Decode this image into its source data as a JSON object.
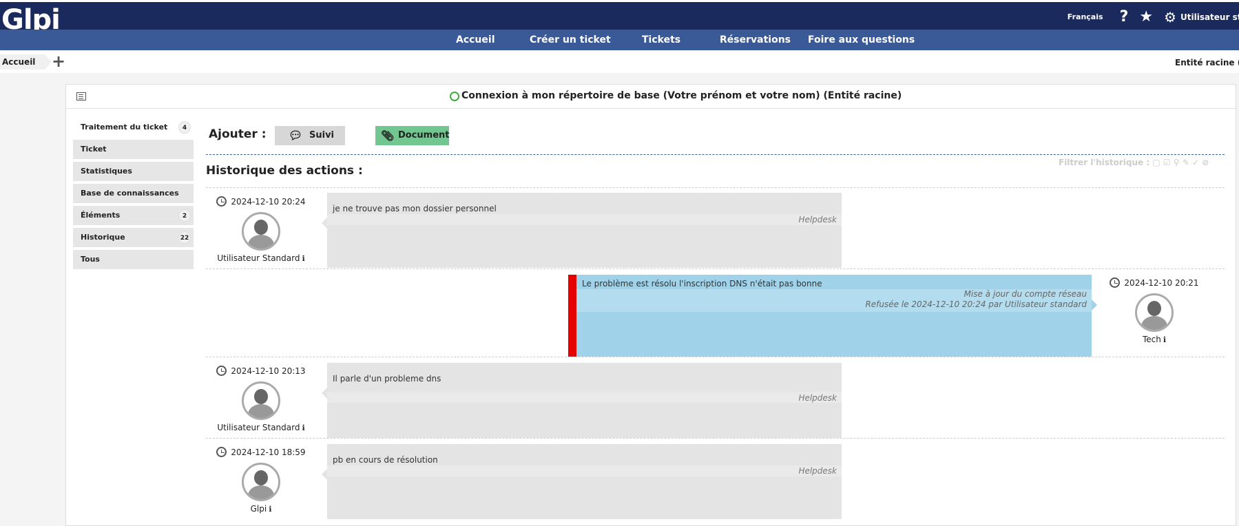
{
  "header": {
    "logo": "Glpi",
    "language": "Français",
    "user": "Utilisateur standard"
  },
  "menu": [
    "Accueil",
    "Créer un ticket",
    "Tickets",
    "Réservations",
    "Foire aux questions"
  ],
  "breadcrumb": "Accueil",
  "entity": "Entité racine (Arborescence)",
  "ticket_title": "Connexion à mon répertoire de base (Votre prénom et votre nom) (Entité racine)",
  "tabs": [
    {
      "label": "Traitement du ticket",
      "badge": "4"
    },
    {
      "label": "Ticket",
      "badge": ""
    },
    {
      "label": "Statistiques",
      "badge": ""
    },
    {
      "label": "Base de connaissances",
      "badge": ""
    },
    {
      "label": "Éléments",
      "badge": "2"
    },
    {
      "label": "Historique",
      "badge": "22"
    },
    {
      "label": "Tous",
      "badge": ""
    }
  ],
  "add": {
    "label": "Ajouter :",
    "followup": "Suivi",
    "document": "Document"
  },
  "history": {
    "title": "Historique des actions :",
    "filter": "Filtrer l'historique :"
  },
  "timeline": [
    {
      "date": "2024-12-10 20:24",
      "author": "Utilisateur Standard",
      "text": "je ne trouve pas mon dossier personnel",
      "source": "Helpdesk"
    },
    {
      "date": "2024-12-10 20:21",
      "author": "Tech",
      "text": "Le problème est résolu l'inscription DNS n'était pas bonne",
      "source": "Mise à jour du compte réseau",
      "status": "Refusée le 2024-12-10 20:24 par Utilisateur standard"
    },
    {
      "date": "2024-12-10 20:13",
      "author": "Utilisateur Standard",
      "text": "Il parle d'un probleme dns",
      "source": "Helpdesk"
    },
    {
      "date": "2024-12-10 18:59",
      "author": "Glpi",
      "text": "pb en cours de résolution",
      "source": "Helpdesk"
    }
  ],
  "colors": {
    "topbar": "#1b2a5c",
    "menubar": "#3a5a97",
    "solution": "#a0d3ea",
    "refused": "#e50000",
    "document_button": "#72c690"
  }
}
